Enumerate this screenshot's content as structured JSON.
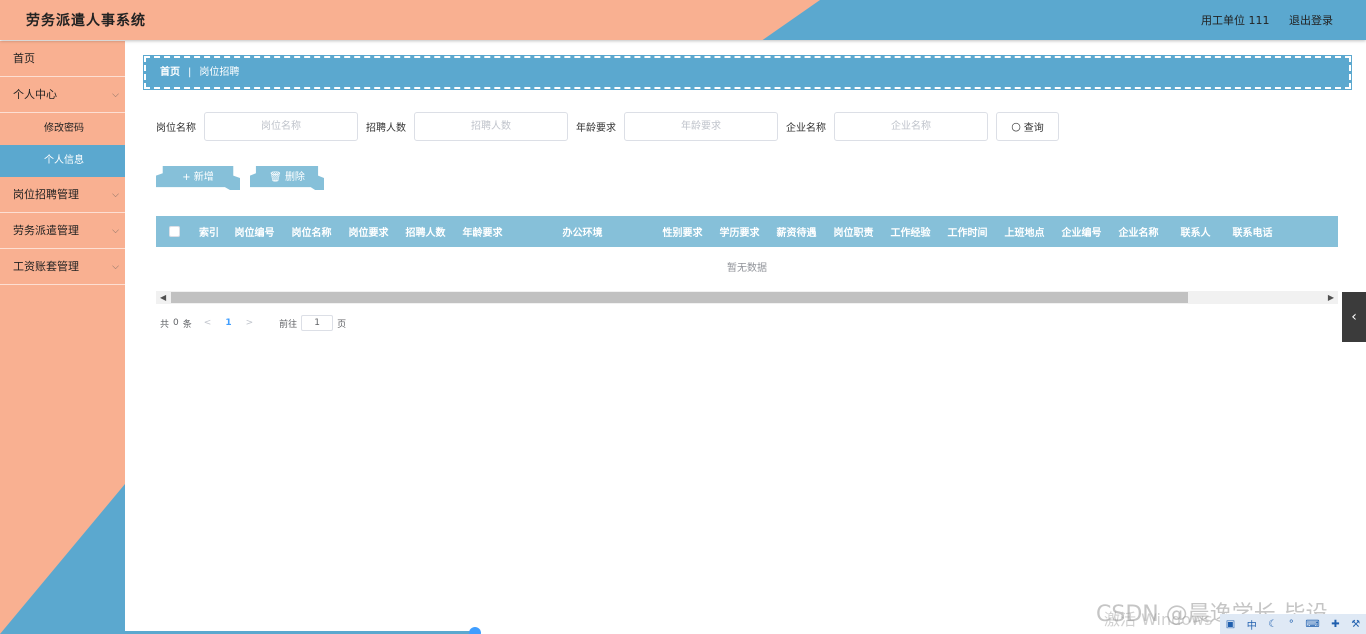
{
  "header": {
    "title": "劳务派遣人事系统",
    "user": "用工单位 111",
    "logout": "退出登录"
  },
  "sidebar": {
    "items": [
      {
        "label": "首页"
      },
      {
        "label": "个人中心",
        "chevron": "chevron-down-icon"
      },
      {
        "label": "修改密码"
      },
      {
        "label": "个人信息"
      },
      {
        "label": "岗位招聘管理",
        "chevron": "chevron-down-icon"
      },
      {
        "label": "劳务派遣管理",
        "chevron": "chevron-down-icon"
      },
      {
        "label": "工资账套管理",
        "chevron": "chevron-down-icon"
      }
    ]
  },
  "breadcrumb": {
    "home": "首页",
    "sep": "|",
    "current": "岗位招聘"
  },
  "search": {
    "fields": [
      {
        "label": "岗位名称",
        "placeholder": "岗位名称"
      },
      {
        "label": "招聘人数",
        "placeholder": "招聘人数"
      },
      {
        "label": "年龄要求",
        "placeholder": "年龄要求"
      },
      {
        "label": "企业名称",
        "placeholder": "企业名称"
      }
    ],
    "button": "查询"
  },
  "actions": {
    "add": "新增",
    "delete": "删除"
  },
  "table": {
    "columns": [
      "索引",
      "岗位编号",
      "岗位名称",
      "岗位要求",
      "招聘人数",
      "年龄要求",
      "办公环境",
      "性别要求",
      "学历要求",
      "薪资待遇",
      "岗位职责",
      "工作经验",
      "工作时间",
      "上班地点",
      "企业编号",
      "企业名称",
      "联系人",
      "联系电话"
    ],
    "empty": "暂无数据"
  },
  "pagination": {
    "total_prefix": "共",
    "total": "0",
    "total_suffix": "条",
    "current_page": "1",
    "goto_label": "前往",
    "goto_value": "1",
    "page_suffix": "页"
  },
  "overlay": {
    "watermark": "CSDN @晨逸学长-毕设",
    "activate": "激活 Windows",
    "tray_lang": "中"
  },
  "colors": {
    "salmon": "#f9b091",
    "blue": "#5ba8cf",
    "table_header": "#86c0d9"
  }
}
